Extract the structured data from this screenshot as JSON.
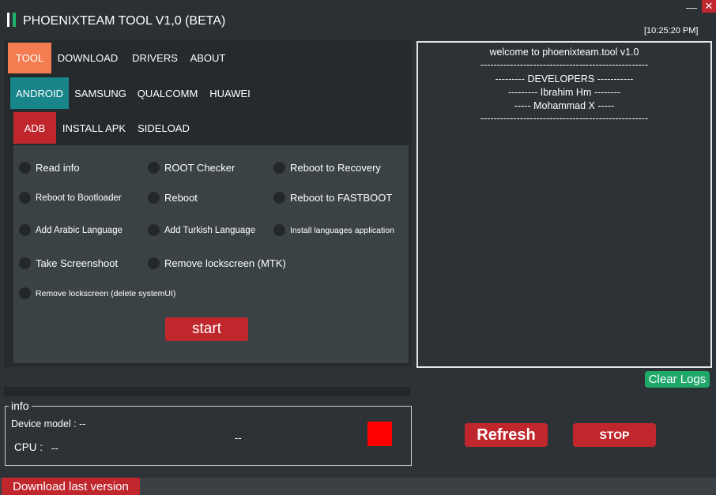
{
  "window": {
    "title": "PHOENIXTEAM TOOL V1,0 (BETA)",
    "clock": "[10:25:20 PM]",
    "minimize_glyph": "—",
    "close_glyph": "✕"
  },
  "tabs_main": [
    {
      "label": "TOOL",
      "active": true
    },
    {
      "label": "DOWNLOAD",
      "active": false
    },
    {
      "label": "DRIVERS",
      "active": false
    },
    {
      "label": "ABOUT",
      "active": false
    }
  ],
  "tabs_brand": [
    {
      "label": "ANDROID",
      "active": true
    },
    {
      "label": "SAMSUNG",
      "active": false
    },
    {
      "label": "QUALCOMM",
      "active": false
    },
    {
      "label": "HUAWEI",
      "active": false
    }
  ],
  "tabs_mode": [
    {
      "label": "ADB",
      "active": true
    },
    {
      "label": "INSTALL APK",
      "active": false
    },
    {
      "label": "SIDELOAD",
      "active": false
    }
  ],
  "options": {
    "read_info": "Read info",
    "root_checker": "ROOT Checker",
    "reboot_recovery": "Reboot to Recovery",
    "reboot_bootloader": "Reboot to Bootloader",
    "reboot": "Reboot",
    "reboot_fastboot": "Reboot to FASTBOOT",
    "add_arabic": "Add  Arabic Language",
    "add_turkish": "Add  Turkish Language",
    "install_languages": "Install languages application",
    "take_screenshot": "Take Screenshoot",
    "remove_lock_mtk": "Remove lockscreen (MTK)",
    "remove_lock_systemui": "Remove lockscreen (delete systemUI)"
  },
  "start_label": "start",
  "log": {
    "lines": [
      "welcome to phoenixteam.tool v1.0",
      "---------------------------------------------------",
      "--------- DEVELOPERS -----------",
      "--------- Ibrahim Hm --------",
      "----- Mohammad X -----",
      "---------------------------------------------------"
    ]
  },
  "clear_logs_label": "Clear Logs",
  "progress": {
    "value": 0
  },
  "info": {
    "legend": "info",
    "device_model": "Device model : --",
    "cpu_label": "CPU :",
    "cpu_value": "--",
    "status_text": "--",
    "status_color": "#ff0000"
  },
  "refresh_label": "Refresh",
  "stop_label": "STOP",
  "download_last_label": "Download last version",
  "colors": {
    "accent_orange": "#f47c51",
    "accent_teal": "#18858a",
    "accent_red": "#c0272d",
    "accent_green": "#1fb36b"
  }
}
